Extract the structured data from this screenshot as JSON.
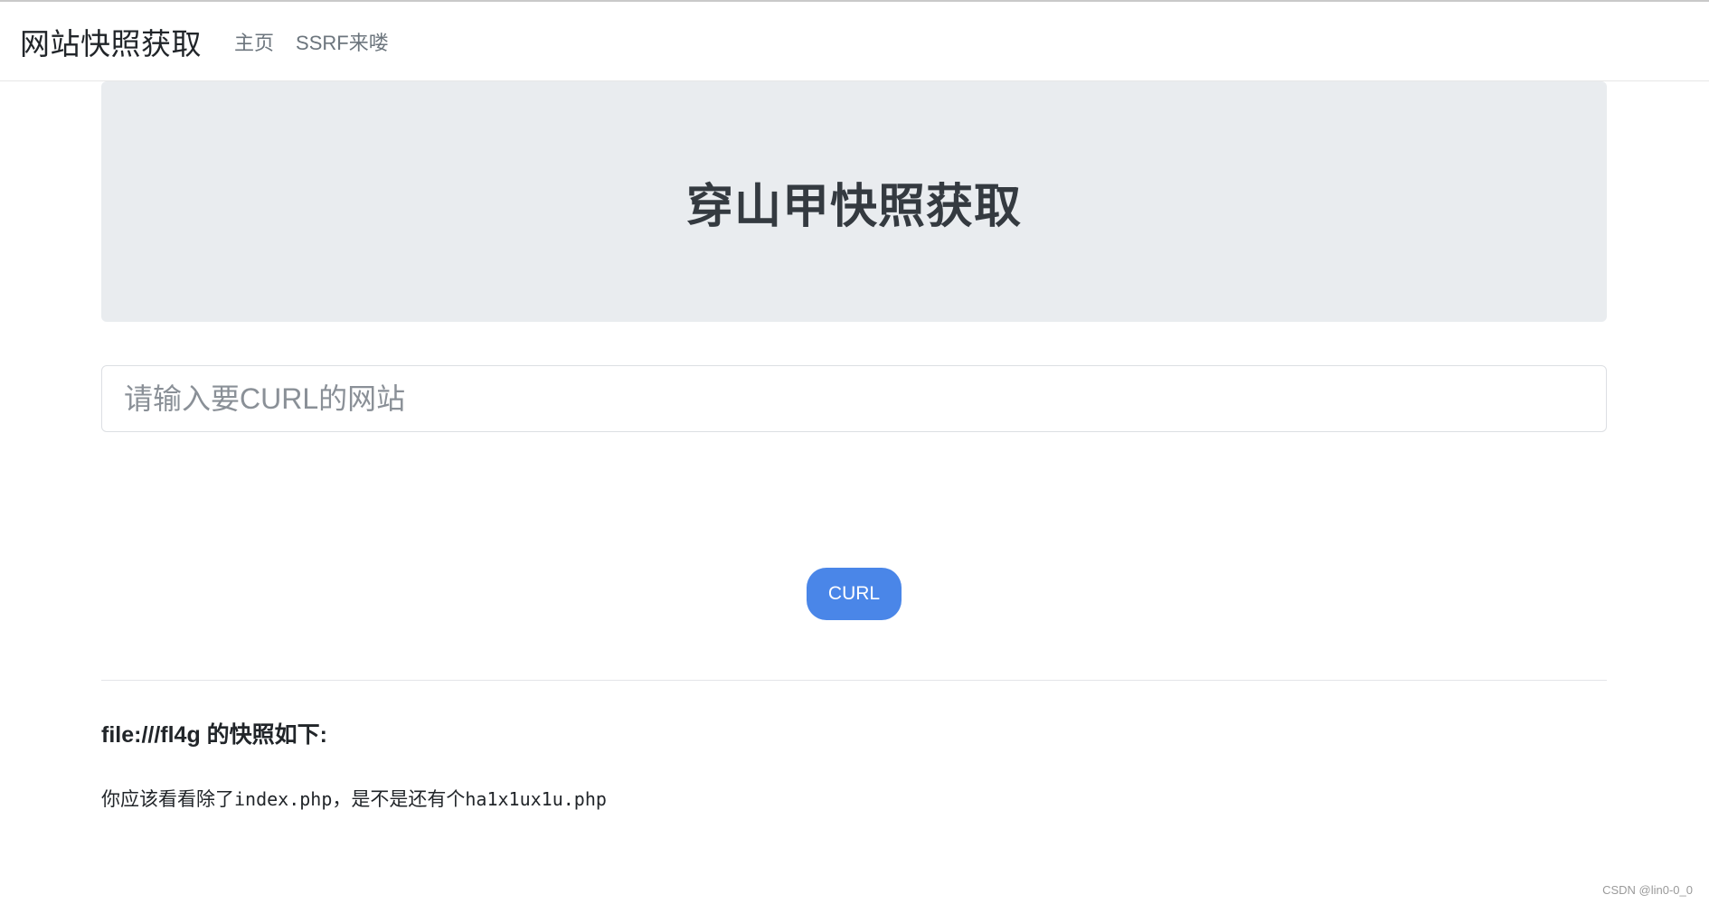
{
  "navbar": {
    "brand": "网站快照获取",
    "links": [
      "主页",
      "SSRF来喽"
    ]
  },
  "hero": {
    "title": "穿山甲快照获取"
  },
  "form": {
    "input_placeholder": "请输入要CURL的网站",
    "input_value": "",
    "button_label": "CURL"
  },
  "result": {
    "title": "file:///fl4g 的快照如下:",
    "body_prefix": "你应该看看除了",
    "body_file1": "index.php",
    "body_middle": "，是不是还有个",
    "body_file2": "ha1x1ux1u.php"
  },
  "watermark": "CSDN @lin0-0_0",
  "colors": {
    "button": "#4a86e8",
    "jumbotron": "#e9ecef"
  }
}
